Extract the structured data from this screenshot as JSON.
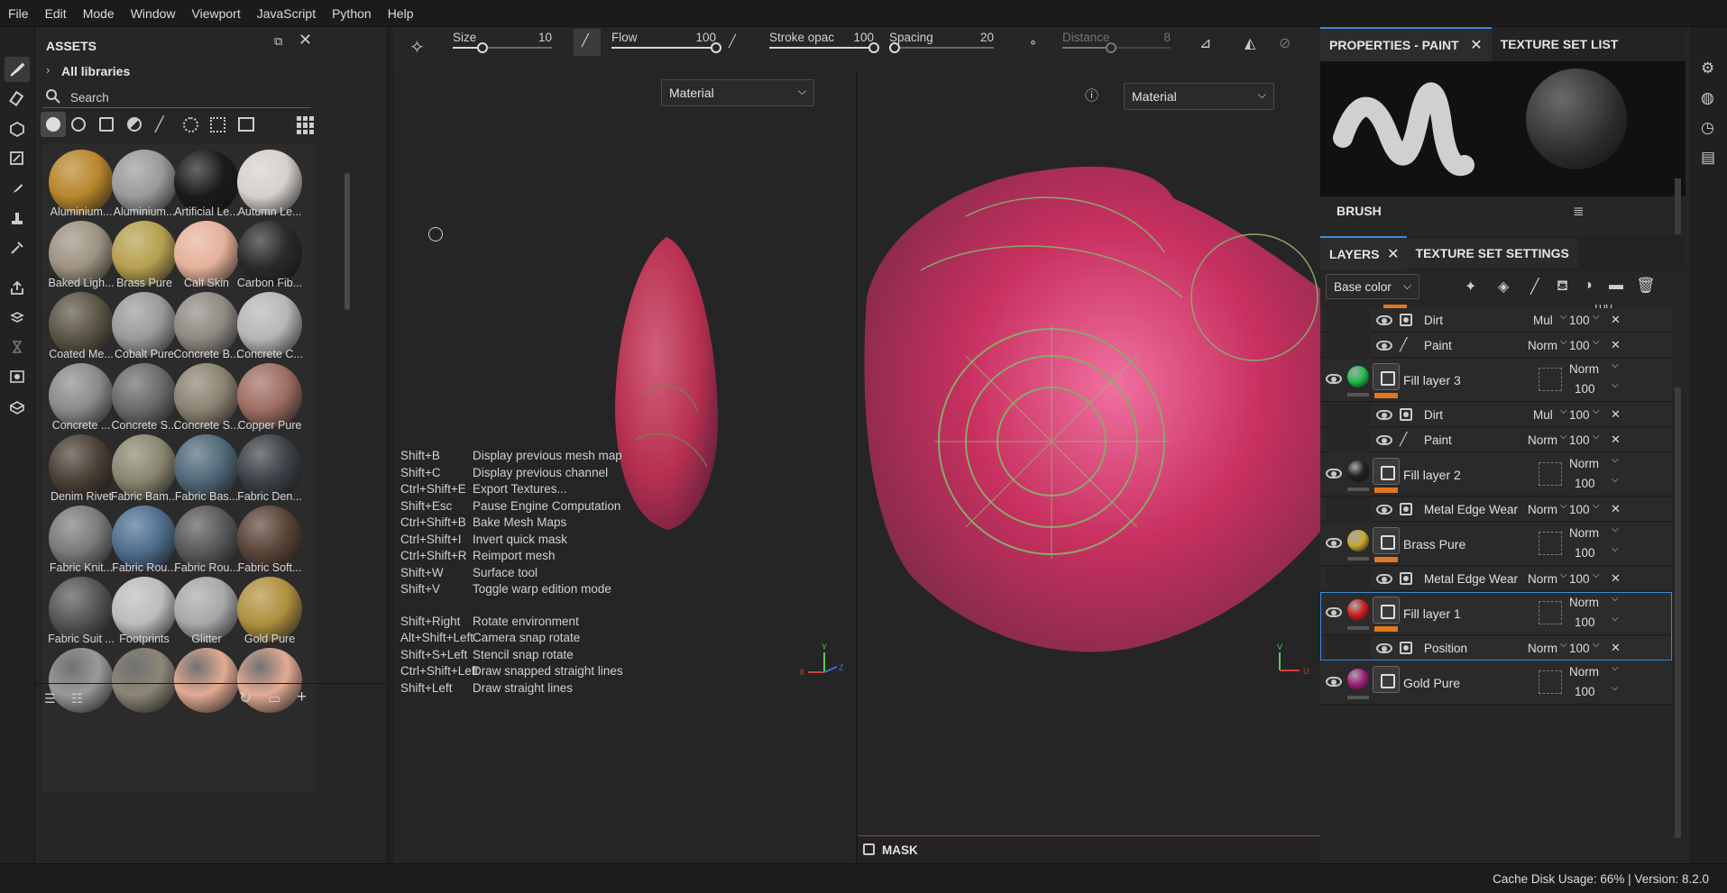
{
  "menu": [
    "File",
    "Edit",
    "Mode",
    "Window",
    "Viewport",
    "JavaScript",
    "Python",
    "Help"
  ],
  "assets": {
    "title": "ASSETS",
    "library": "All libraries",
    "search_placeholder": "Search",
    "items": [
      {
        "label": "Aluminium...",
        "color": "#b8862c"
      },
      {
        "label": "Aluminium...",
        "color": "#9a9a9a"
      },
      {
        "label": "Artificial Le...",
        "color": "#1b1b1b"
      },
      {
        "label": "Autumn Le...",
        "color": "#d5d0cc"
      },
      {
        "label": "Baked Ligh...",
        "color": "#9d9282"
      },
      {
        "label": "Brass Pure",
        "color": "#b6a050"
      },
      {
        "label": "Calf Skin",
        "color": "#e5b19a"
      },
      {
        "label": "Carbon Fib...",
        "color": "#2a2a2a"
      },
      {
        "label": "Coated Me...",
        "color": "#5b5545"
      },
      {
        "label": "Cobalt Pure",
        "color": "#9a9a9a"
      },
      {
        "label": "Concrete B...",
        "color": "#8e8a82"
      },
      {
        "label": "Concrete C...",
        "color": "#b6b6b6"
      },
      {
        "label": "Concrete ...",
        "color": "#8a8a8a"
      },
      {
        "label": "Concrete S...",
        "color": "#6a6a6a"
      },
      {
        "label": "Concrete S...",
        "color": "#8c8272"
      },
      {
        "label": "Copper Pure",
        "color": "#9e6e62"
      },
      {
        "label": "Denim Rivet",
        "color": "#4a4036"
      },
      {
        "label": "Fabric Bam...",
        "color": "#8a8670"
      },
      {
        "label": "Fabric Bas...",
        "color": "#4f6878"
      },
      {
        "label": "Fabric Den...",
        "color": "#3c4248"
      },
      {
        "label": "Fabric Knit...",
        "color": "#7a7a7a"
      },
      {
        "label": "Fabric Rou...",
        "color": "#4e6e8e"
      },
      {
        "label": "Fabric Rou...",
        "color": "#595959"
      },
      {
        "label": "Fabric Soft...",
        "color": "#5a4438"
      },
      {
        "label": "Fabric Suit ...",
        "color": "#555555"
      },
      {
        "label": "Footprints",
        "color": "#bcbcbc"
      },
      {
        "label": "Glitter",
        "color": "#a8a8a8"
      },
      {
        "label": "Gold Pure",
        "color": "#b09040"
      }
    ],
    "bottom_row_colors": [
      "#9a9a9a",
      "#8c8676",
      "#e2ab94",
      "#e2ab94"
    ]
  },
  "toolbar": {
    "size": {
      "label": "Size",
      "value": "10",
      "fill": 0.3
    },
    "flow": {
      "label": "Flow",
      "value": "100",
      "fill": 1.0
    },
    "stroke": {
      "label": "Stroke opac",
      "value": "100",
      "fill": 1.0
    },
    "spacing": {
      "label": "Spacing",
      "value": "20",
      "fill": 0.05
    },
    "distance": {
      "label": "Distance",
      "value": "8",
      "fill": 0.45
    }
  },
  "viewport": {
    "left_dropdown": "Material",
    "right_dropdown": "Material",
    "mask_label": "MASK",
    "axes_left": {
      "y": "Y",
      "x": "X",
      "z": "Z"
    },
    "axes_right": {
      "v": "V",
      "u": "U"
    }
  },
  "shortcuts": [
    {
      "key": "Shift+B",
      "desc": "Display previous mesh map"
    },
    {
      "key": "Shift+C",
      "desc": "Display previous channel"
    },
    {
      "key": "Ctrl+Shift+E",
      "desc": "Export Textures..."
    },
    {
      "key": "Shift+Esc",
      "desc": "Pause Engine Computation"
    },
    {
      "key": "Ctrl+Shift+B",
      "desc": "Bake Mesh Maps"
    },
    {
      "key": "Ctrl+Shift+I",
      "desc": "Invert quick mask"
    },
    {
      "key": "Ctrl+Shift+R",
      "desc": "Reimport mesh"
    },
    {
      "key": "Shift+W",
      "desc": "Surface tool"
    },
    {
      "key": "Shift+V",
      "desc": "Toggle warp edition mode"
    },
    {
      "key": "Shift+Right",
      "desc": "Rotate environment"
    },
    {
      "key": "Alt+Shift+Left",
      "desc": "Camera snap rotate"
    },
    {
      "key": "Shift+S+Left",
      "desc": "Stencil snap rotate"
    },
    {
      "key": "Ctrl+Shift+Left",
      "desc": "Draw snapped straight lines"
    },
    {
      "key": "Shift+Left",
      "desc": "Draw straight lines"
    }
  ],
  "properties": {
    "tab1": "PROPERTIES - PAINT",
    "tab2": "TEXTURE SET LIST",
    "brush_label": "BRUSH"
  },
  "layers": {
    "tab1": "LAYERS",
    "tab2": "TEXTURE SET SETTINGS",
    "channel": "Base color",
    "partial_top": "100",
    "rows": [
      {
        "kind": "sub",
        "name": "Dirt",
        "blend": "Mul",
        "opacity": "100",
        "icon": "mask"
      },
      {
        "kind": "sub",
        "name": "Paint",
        "blend": "Norm",
        "opacity": "100",
        "icon": "brush"
      },
      {
        "kind": "fill",
        "name": "Fill layer 3",
        "blend": "Norm",
        "opacity": "100",
        "color": "#1fbf4f"
      },
      {
        "kind": "sub",
        "name": "Dirt",
        "blend": "Mul",
        "opacity": "100",
        "icon": "mask"
      },
      {
        "kind": "sub",
        "name": "Paint",
        "blend": "Norm",
        "opacity": "100",
        "icon": "brush"
      },
      {
        "kind": "fill",
        "name": "Fill layer 2",
        "blend": "Norm",
        "opacity": "100",
        "color": "#222222"
      },
      {
        "kind": "sub",
        "name": "Metal Edge Wear",
        "blend": "Norm",
        "opacity": "100",
        "icon": "mask"
      },
      {
        "kind": "fill",
        "name": "Brass Pure",
        "blend": "Norm",
        "opacity": "100",
        "color": "#c8a830"
      },
      {
        "kind": "sub",
        "name": "Metal Edge Wear",
        "blend": "Norm",
        "opacity": "100",
        "icon": "mask"
      },
      {
        "kind": "fill",
        "name": "Fill layer 1",
        "blend": "Norm",
        "opacity": "100",
        "color": "#d02020",
        "selected": true
      },
      {
        "kind": "sub",
        "name": "Position",
        "blend": "Norm",
        "opacity": "100",
        "icon": "mask",
        "selected": true
      },
      {
        "kind": "fill",
        "name": "Gold Pure",
        "blend": "Norm",
        "opacity": "100",
        "color": "#a02080",
        "noorange": true
      }
    ]
  },
  "status": "Cache Disk Usage:   66% | Version: 8.2.0"
}
